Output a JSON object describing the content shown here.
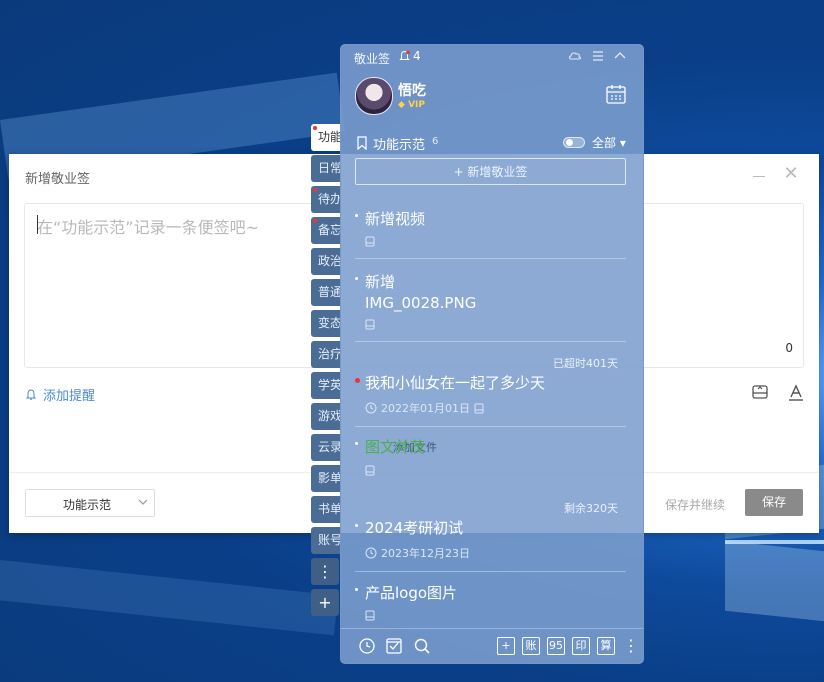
{
  "dialog": {
    "title": "新增敬业签",
    "placeholder": "在“功能示范”记录一条便签吧~",
    "char_count": "0",
    "remind_label": "添加提醒",
    "category_value": "功能示范",
    "save_continue_label": "保存并继续",
    "save_label": "保存"
  },
  "tabs": [
    {
      "label": "功能",
      "active": true,
      "dot": true
    },
    {
      "label": "日常"
    },
    {
      "label": "待办",
      "dot": true
    },
    {
      "label": "备忘",
      "dot": true
    },
    {
      "label": "政治"
    },
    {
      "label": "普通"
    },
    {
      "label": "变态"
    },
    {
      "label": "治疗"
    },
    {
      "label": "学英"
    },
    {
      "label": "游戏"
    },
    {
      "label": "云录"
    },
    {
      "label": "影单"
    },
    {
      "label": "书单"
    },
    {
      "label": "账号"
    }
  ],
  "panel": {
    "app_title": "敬业签",
    "notification_count": "4",
    "username": "悟吃",
    "vip_label": "VIP",
    "category_name": "功能示范",
    "category_count": "6",
    "filter_label": "全部",
    "add_note_label": "+ 新增敬业签",
    "notes": [
      {
        "text": "新增视频"
      },
      {
        "text_line1": "新增",
        "text_line2": "IMG_0028.PNG"
      },
      {
        "status": "已超时401天",
        "text": "我和小仙女在一起了多少天",
        "date": "2022年01月01日"
      },
      {
        "text": "图文并茂",
        "overlay": "添加文件"
      },
      {
        "status": "剩余320天",
        "text": "2024考研初试",
        "date": "2023年12月23日"
      },
      {
        "text": "产品logo图片"
      }
    ],
    "bottom_buttons": [
      "账",
      "95",
      "印",
      "算"
    ]
  },
  "colors": {
    "accent_link": "#4a8bd6",
    "panel_bg": "#7c9ece",
    "red_dot": "#e53935",
    "green_text": "#4caf50"
  }
}
